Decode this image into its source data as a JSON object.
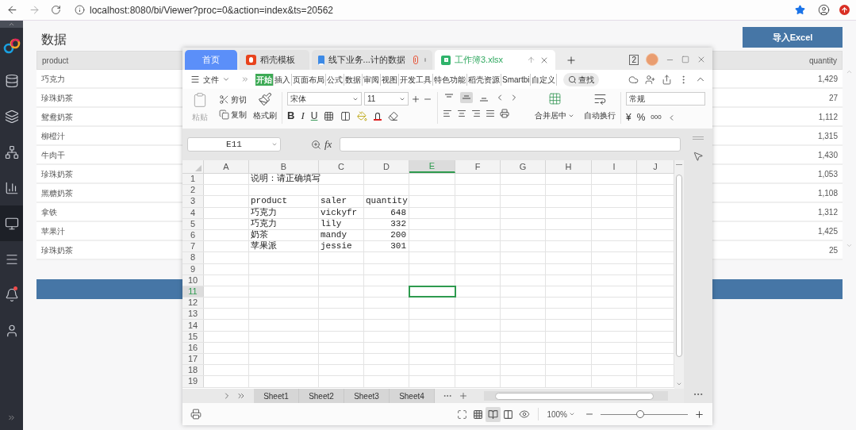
{
  "browser": {
    "url": "localhost:8080/bi/Viewer?proc=0&action=index&ts=20562"
  },
  "sidebar": {
    "items": [
      {
        "selected": false,
        "unread": false
      },
      {
        "selected": false,
        "unread": false
      },
      {
        "selected": false,
        "unread": false
      },
      {
        "selected": false,
        "unread": false
      },
      {
        "selected": true,
        "unread": false
      },
      {
        "selected": false,
        "unread": false
      },
      {
        "selected": false,
        "unread": true
      },
      {
        "selected": false,
        "unread": false
      }
    ]
  },
  "page": {
    "title": "数据",
    "import_button": "导入Excel",
    "table": {
      "columns": [
        "product",
        "quantity"
      ],
      "rows": [
        {
          "product": "巧克力",
          "quantity": "1,429"
        },
        {
          "product": "珍珠奶茶",
          "quantity": "27"
        },
        {
          "product": "鸳鸯奶茶",
          "quantity": "1,112"
        },
        {
          "product": "柳橙汁",
          "quantity": "1,315"
        },
        {
          "product": "牛肉干",
          "quantity": "1,430"
        },
        {
          "product": "珍珠奶茶",
          "quantity": "1,053"
        },
        {
          "product": "黑糖奶茶",
          "quantity": "1,108"
        },
        {
          "product": "拿铁",
          "quantity": "1,312"
        },
        {
          "product": "苹果汁",
          "quantity": "1,425"
        },
        {
          "product": "珍珠奶茶",
          "quantity": "25"
        }
      ]
    }
  },
  "spreadsheet_app": {
    "tabs": [
      {
        "kind": "home",
        "label": "首页",
        "selected": false
      },
      {
        "kind": "template",
        "label": "稻壳模板",
        "selected": false
      },
      {
        "kind": "document",
        "label": "线下业务...计的数据",
        "selected": false
      },
      {
        "kind": "workbook",
        "label": "工作簿3.xlsx",
        "selected": true
      }
    ],
    "window_count": "2",
    "file_menu": "文件",
    "ribbon_tabs": [
      {
        "label": "开始",
        "selected": true
      },
      {
        "label": "插入",
        "selected": false
      },
      {
        "label": "页面布局",
        "selected": false
      },
      {
        "label": "公式",
        "selected": false
      },
      {
        "label": "数据",
        "selected": false
      },
      {
        "label": "审阅",
        "selected": false
      },
      {
        "label": "视图",
        "selected": false
      },
      {
        "label": "开发工具",
        "selected": false
      },
      {
        "label": "特色功能",
        "selected": false
      },
      {
        "label": "稻壳资源",
        "selected": false
      },
      {
        "label": "Smartbi",
        "selected": false
      },
      {
        "label": "自定义",
        "selected": false
      }
    ],
    "search": "查找",
    "clipboard": {
      "paste": "粘贴",
      "paste_disabled": true,
      "cut": "剪切",
      "copy": "复制",
      "format_painter": "格式刷"
    },
    "font": {
      "family": "宋体",
      "size": "11",
      "bold": "B",
      "italic": "I",
      "underline": "U"
    },
    "vertical_align": [
      {
        "selected": false
      },
      {
        "selected": true
      },
      {
        "selected": false
      }
    ],
    "alignment": {
      "merge": "合并居中",
      "wrap": "自动换行"
    },
    "number": {
      "format": "常规",
      "currency": "¥",
      "percent": "%",
      "thousands": "000"
    },
    "name_box": "E11",
    "fx": "fx",
    "columns": [
      {
        "label": "A",
        "selected": false
      },
      {
        "label": "B",
        "selected": false
      },
      {
        "label": "C",
        "selected": false
      },
      {
        "label": "D",
        "selected": false
      },
      {
        "label": "E",
        "selected": true
      },
      {
        "label": "F",
        "selected": false
      },
      {
        "label": "G",
        "selected": false
      },
      {
        "label": "H",
        "selected": false
      },
      {
        "label": "I",
        "selected": false
      },
      {
        "label": "J",
        "selected": false
      }
    ],
    "rows": [
      {
        "label": "1",
        "selected": false,
        "cells": {
          "B": {
            "kind": "text",
            "text": "说明：请正确填写"
          }
        }
      },
      {
        "label": "2",
        "selected": false
      },
      {
        "label": "3",
        "selected": false,
        "cells": {
          "B": {
            "kind": "text",
            "text": "product"
          },
          "C": {
            "kind": "text",
            "text": "saler"
          },
          "D": {
            "kind": "text",
            "text": "quantity"
          }
        }
      },
      {
        "label": "4",
        "selected": false,
        "cells": {
          "B": {
            "kind": "text",
            "text": "巧克力"
          },
          "C": {
            "kind": "text",
            "text": "vickyfr"
          },
          "D": {
            "kind": "number",
            "text": "648"
          }
        }
      },
      {
        "label": "5",
        "selected": false,
        "cells": {
          "B": {
            "kind": "text",
            "text": "巧克力"
          },
          "C": {
            "kind": "text",
            "text": "lily"
          },
          "D": {
            "kind": "number",
            "text": "332"
          }
        }
      },
      {
        "label": "6",
        "selected": false,
        "cells": {
          "B": {
            "kind": "text",
            "text": "奶茶"
          },
          "C": {
            "kind": "text",
            "text": "mandy"
          },
          "D": {
            "kind": "number",
            "text": "200"
          }
        }
      },
      {
        "label": "7",
        "selected": false,
        "cells": {
          "B": {
            "kind": "text",
            "text": "苹果派"
          },
          "C": {
            "kind": "text",
            "text": "jessie"
          },
          "D": {
            "kind": "number",
            "text": "301"
          }
        }
      },
      {
        "label": "8",
        "selected": false
      },
      {
        "label": "9",
        "selected": false
      },
      {
        "label": "10",
        "selected": false
      },
      {
        "label": "11",
        "selected": true
      },
      {
        "label": "12",
        "selected": false
      },
      {
        "label": "13",
        "selected": false
      },
      {
        "label": "14",
        "selected": false
      },
      {
        "label": "15",
        "selected": false
      },
      {
        "label": "16",
        "selected": false
      },
      {
        "label": "17",
        "selected": false
      },
      {
        "label": "18",
        "selected": false
      },
      {
        "label": "19",
        "selected": false
      }
    ],
    "sheets": [
      {
        "label": "Sheet1",
        "selected": false
      },
      {
        "label": "Sheet2",
        "selected": false
      },
      {
        "label": "Sheet3",
        "selected": false
      },
      {
        "label": "Sheet4",
        "selected": false
      }
    ],
    "view_modes": [
      {
        "selected": false
      },
      {
        "selected": true
      },
      {
        "selected": false
      }
    ],
    "zoom": {
      "label": "100%",
      "level": 0.45
    }
  }
}
